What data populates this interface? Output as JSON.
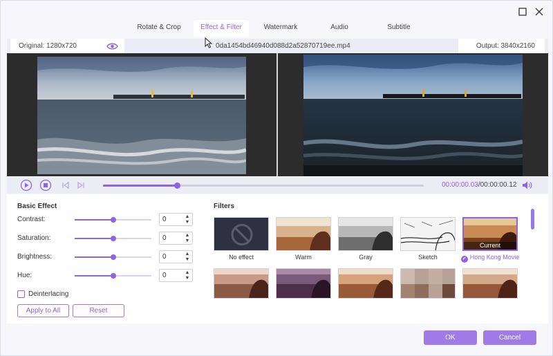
{
  "window": {
    "maximize_icon": "maximize-icon",
    "close_icon": "close-icon"
  },
  "tabs": [
    {
      "label": "Rotate & Crop",
      "active": false
    },
    {
      "label": "Effect & Filter",
      "active": true
    },
    {
      "label": "Watermark",
      "active": false
    },
    {
      "label": "Audio",
      "active": false
    },
    {
      "label": "Subtitle",
      "active": false
    }
  ],
  "infobar": {
    "original": "Original: 1280x720",
    "filename": "0da1454bd46940d088d2a52870719ee.mp4",
    "output": "Output: 3840x2160"
  },
  "player": {
    "progress": 0.23,
    "time_current": "00:00:00.03",
    "time_separator": "/",
    "time_total": "00:00:00.12"
  },
  "basic_effect": {
    "title": "Basic Effect",
    "rows": [
      {
        "label": "Contrast:",
        "value": "0",
        "level": 0.5
      },
      {
        "label": "Saturation:",
        "value": "0",
        "level": 0.5
      },
      {
        "label": "Brightness:",
        "value": "0",
        "level": 0.5
      },
      {
        "label": "Hue:",
        "value": "0",
        "level": 0.5
      }
    ],
    "deinterlacing_label": "Deinterlacing",
    "deinterlacing_checked": false,
    "apply_all_label": "Apply to All",
    "reset_label": "Reset"
  },
  "filters": {
    "title": "Filters",
    "items": [
      {
        "label": "No effect",
        "style": "none"
      },
      {
        "label": "Warm",
        "style": "warm"
      },
      {
        "label": "Gray",
        "style": "gray"
      },
      {
        "label": "Sketch",
        "style": "sketch"
      },
      {
        "label": "Hong Kong Movie",
        "style": "hk",
        "selected": true,
        "tag": "Current"
      },
      {
        "label": "",
        "style": "warm2"
      },
      {
        "label": "",
        "style": "purple"
      },
      {
        "label": "",
        "style": "warm3"
      },
      {
        "label": "",
        "style": "mosaic"
      },
      {
        "label": "",
        "style": "warm4"
      }
    ]
  },
  "footer": {
    "ok_label": "OK",
    "cancel_label": "Cancel"
  },
  "colors": {
    "accent": "#8e63e6",
    "button": "#a07be8"
  }
}
